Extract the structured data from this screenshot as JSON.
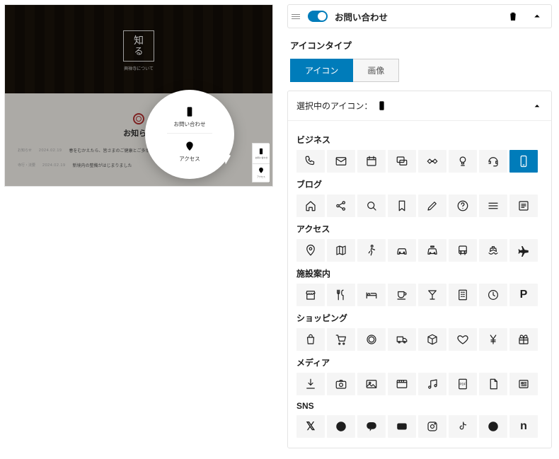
{
  "preview": {
    "hero_title_line1": "知",
    "hero_title_line2": "る",
    "hero_subtitle": "興禅寺について",
    "section_title": "お知らせ",
    "rows": [
      {
        "tag": "お知らせ",
        "date": "2024.02.19",
        "text": "春をむかえたら、皆さまのご健康とご多幸をお祈り申し上げます"
      },
      {
        "tag": "寺行・法要",
        "date": "2024.02.19",
        "text": "新境内の整備がはじまりました"
      }
    ],
    "bubble": {
      "item1": "お問い合わせ",
      "item2": "アクセス"
    },
    "fab": {
      "item1": "お問い合わせ",
      "item2": "アクセス"
    }
  },
  "panel": {
    "title": "お問い合わせ",
    "sectionLabel": "アイコンタイプ",
    "tabs": {
      "icon": "アイコン",
      "image": "画像"
    },
    "card_head": "選択中のアイコン：",
    "selected_icon": "smartphone",
    "groups": [
      {
        "title": "ビジネス",
        "icons": [
          "phone",
          "mail",
          "calendar",
          "chat",
          "handshake",
          "bulb",
          "headset",
          "smartphone"
        ]
      },
      {
        "title": "ブログ",
        "icons": [
          "home",
          "share",
          "search",
          "bookmark",
          "pencil",
          "help",
          "menu",
          "article"
        ]
      },
      {
        "title": "アクセス",
        "icons": [
          "pin",
          "map",
          "walk",
          "car",
          "taxi",
          "bus",
          "ship",
          "plane"
        ]
      },
      {
        "title": "施設案内",
        "icons": [
          "store",
          "restaurant",
          "bed",
          "cafe",
          "bar",
          "building",
          "clock",
          "parking"
        ]
      },
      {
        "title": "ショッピング",
        "icons": [
          "bag",
          "cart",
          "coin",
          "truck",
          "cube",
          "heart",
          "yen",
          "gift"
        ]
      },
      {
        "title": "メディア",
        "icons": [
          "download",
          "camera",
          "image",
          "movie",
          "music",
          "pdf",
          "file",
          "news"
        ]
      },
      {
        "title": "SNS",
        "icons": [
          "x",
          "facebook",
          "line",
          "youtube",
          "instagram",
          "tiktok",
          "pinterest",
          "note"
        ]
      }
    ]
  }
}
